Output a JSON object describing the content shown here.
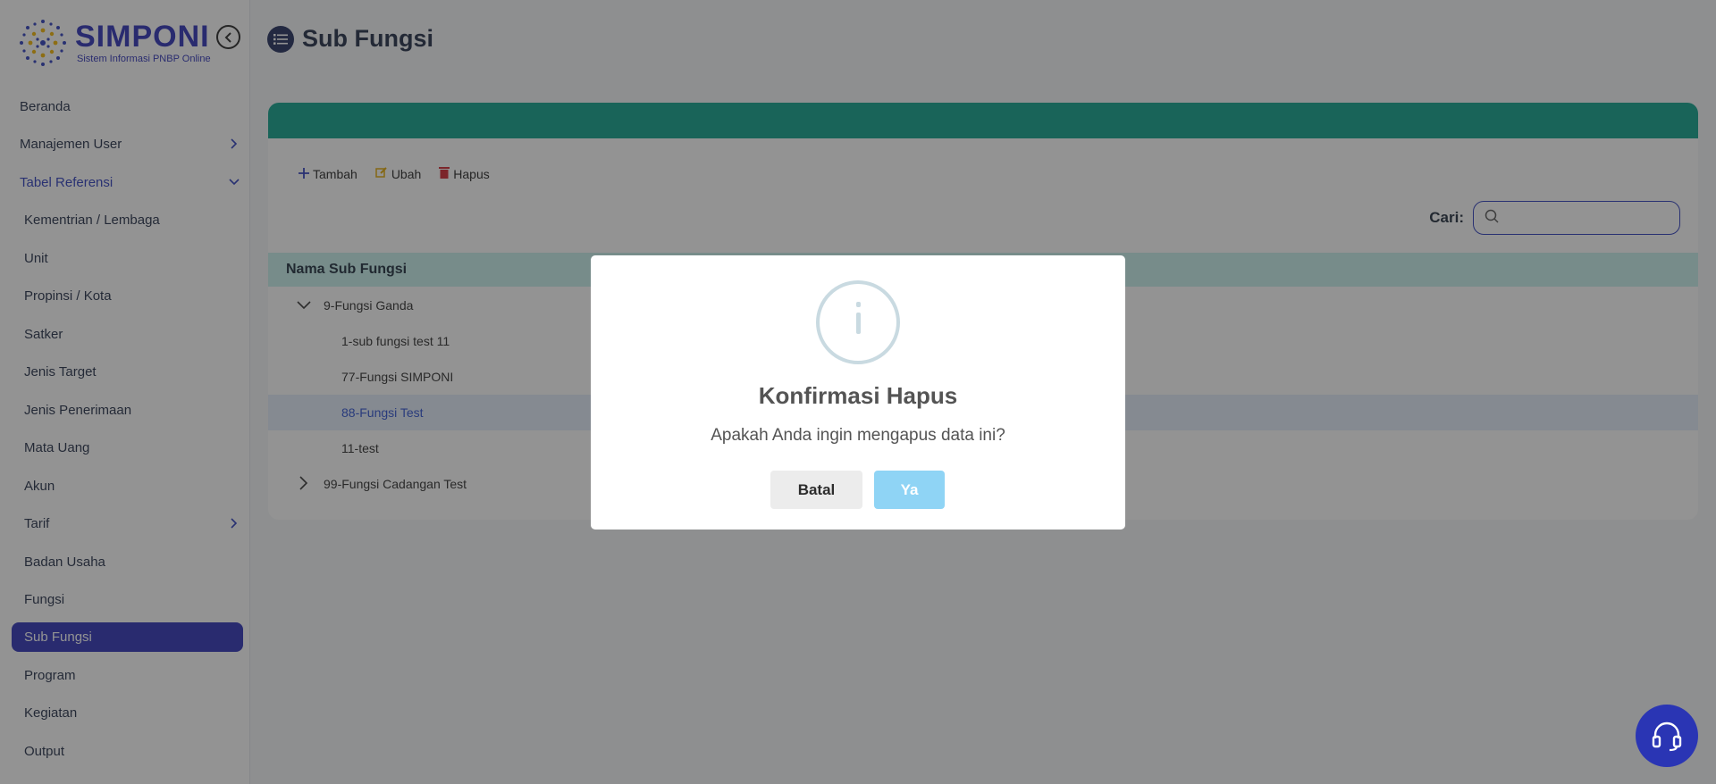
{
  "brand": {
    "title": "SIMPONI",
    "subtitle": "Sistem Informasi PNBP Online"
  },
  "sidebar": {
    "items": [
      {
        "label": "Beranda",
        "type": "top"
      },
      {
        "label": "Manajemen User",
        "type": "top",
        "chevron": "chevron-right-icon"
      },
      {
        "label": "Tabel Referensi",
        "type": "top",
        "chevron": "chevron-down-icon",
        "expanded": true
      },
      {
        "label": "Kementrian / Lembaga",
        "type": "sub"
      },
      {
        "label": "Unit",
        "type": "sub"
      },
      {
        "label": "Propinsi / Kota",
        "type": "sub"
      },
      {
        "label": "Satker",
        "type": "sub"
      },
      {
        "label": "Jenis Target",
        "type": "sub"
      },
      {
        "label": "Jenis Penerimaan",
        "type": "sub"
      },
      {
        "label": "Mata Uang",
        "type": "sub"
      },
      {
        "label": "Akun",
        "type": "sub"
      },
      {
        "label": "Tarif",
        "type": "sub",
        "chevron": "chevron-right-icon"
      },
      {
        "label": "Badan Usaha",
        "type": "sub"
      },
      {
        "label": "Fungsi",
        "type": "sub"
      },
      {
        "label": "Sub Fungsi",
        "type": "sub",
        "active": true
      },
      {
        "label": "Program",
        "type": "sub"
      },
      {
        "label": "Kegiatan",
        "type": "sub"
      },
      {
        "label": "Output",
        "type": "sub"
      }
    ]
  },
  "page": {
    "title": "Sub Fungsi"
  },
  "toolbar": {
    "add": "Tambah",
    "edit": "Ubah",
    "delete": "Hapus"
  },
  "search": {
    "label": "Cari:",
    "placeholder": ""
  },
  "table": {
    "header": "Nama Sub Fungsi",
    "rows": [
      {
        "label": "9-Fungsi Ganda",
        "level": 0,
        "toggle": "chevron-down-icon"
      },
      {
        "label": "1-sub fungsi test 11",
        "level": 1
      },
      {
        "label": "77-Fungsi SIMPONI",
        "level": 1
      },
      {
        "label": "88-Fungsi Test",
        "level": 1,
        "selected": true
      },
      {
        "label": "11-test",
        "level": 1
      },
      {
        "label": "99-Fungsi Cadangan Test",
        "level": 0,
        "toggle": "chevron-right-icon"
      }
    ]
  },
  "modal": {
    "icon": "info-icon",
    "title": "Konfirmasi Hapus",
    "message": "Apakah Anda ingin mengapus data ini?",
    "cancel_label": "Batal",
    "confirm_label": "Ya"
  },
  "colors": {
    "brand": "#2a2fb7",
    "header_band": "#0aa08a",
    "table_head": "#c6f0ec",
    "confirm": "#8fd4f5"
  }
}
